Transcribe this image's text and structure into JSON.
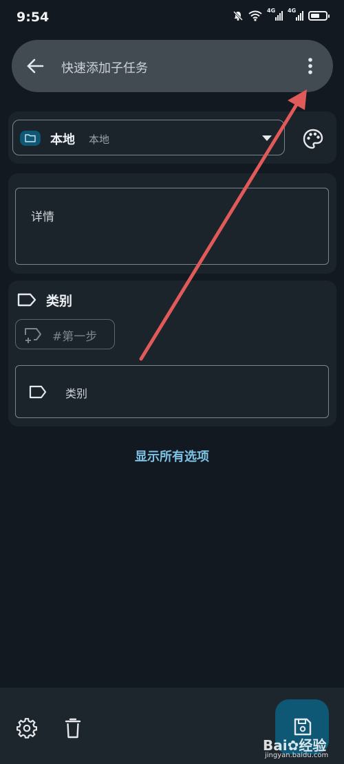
{
  "status_bar": {
    "time": "9:54",
    "network_label_1": "4G",
    "network_label_2": "4G",
    "icons": [
      "mute-bell-icon",
      "wifi-icon",
      "signal-icon",
      "signal-icon",
      "battery-icon"
    ]
  },
  "header": {
    "title_placeholder": "快速添加子任务",
    "back_icon": "arrow-left-icon",
    "more_icon": "vertical-dots-icon"
  },
  "list_selector": {
    "name": "本地",
    "account": "本地",
    "folder_icon": "folder-icon",
    "dropdown_icon": "triangle-down-icon",
    "color_icon": "palette-icon"
  },
  "details": {
    "placeholder": "详情"
  },
  "categories": {
    "header_label": "类别",
    "suggestion_chip": "#第一步",
    "field_placeholder": "类别"
  },
  "show_all_label": "显示所有选项",
  "bottom_bar": {
    "settings_icon": "gear-icon",
    "delete_icon": "trash-icon",
    "save_icon": "save-icon"
  },
  "watermark": {
    "brand": "Bai",
    "brand_suffix": "经验",
    "domain": "jingyan.baidu.com"
  },
  "colors": {
    "background": "#121920",
    "card": "#1b232b",
    "search_bar": "#434b52",
    "accent_link": "#7cc3e6",
    "fab": "#0f5875",
    "annotation_arrow": "#e05a5a"
  }
}
